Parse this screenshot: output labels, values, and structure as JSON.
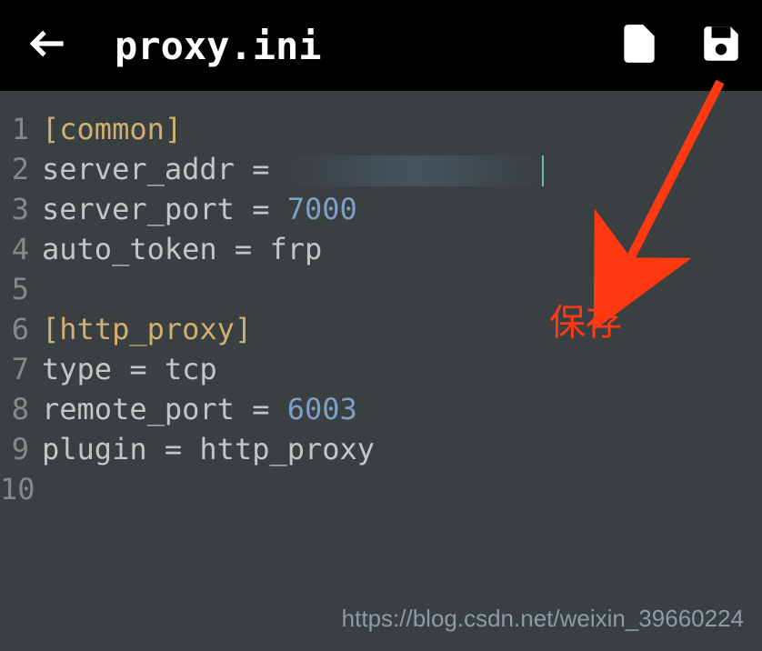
{
  "header": {
    "title": "proxy.ini"
  },
  "code": {
    "lines": [
      {
        "n": "1",
        "tokens": [
          {
            "t": "section",
            "v": "[common]"
          }
        ]
      },
      {
        "n": "2",
        "tokens": [
          {
            "t": "key",
            "v": "server_addr"
          },
          {
            "t": "eq",
            "v": " = "
          },
          {
            "t": "redacted",
            "v": ""
          }
        ]
      },
      {
        "n": "3",
        "tokens": [
          {
            "t": "key",
            "v": "server_port"
          },
          {
            "t": "eq",
            "v": " = "
          },
          {
            "t": "num",
            "v": "7000"
          }
        ]
      },
      {
        "n": "4",
        "tokens": [
          {
            "t": "key",
            "v": "auto_token"
          },
          {
            "t": "eq",
            "v": " = "
          },
          {
            "t": "val",
            "v": "frp"
          }
        ]
      },
      {
        "n": "5",
        "tokens": []
      },
      {
        "n": "6",
        "tokens": [
          {
            "t": "section",
            "v": "[http_proxy]"
          }
        ]
      },
      {
        "n": "7",
        "tokens": [
          {
            "t": "key",
            "v": "type"
          },
          {
            "t": "eq",
            "v": " = "
          },
          {
            "t": "val",
            "v": "tcp"
          }
        ]
      },
      {
        "n": "8",
        "tokens": [
          {
            "t": "key",
            "v": "remote_port"
          },
          {
            "t": "eq",
            "v": " = "
          },
          {
            "t": "num",
            "v": "6003"
          }
        ]
      },
      {
        "n": "9",
        "tokens": [
          {
            "t": "key",
            "v": "plugin"
          },
          {
            "t": "eq",
            "v": " = "
          },
          {
            "t": "val",
            "v": "http_proxy"
          }
        ]
      },
      {
        "n": "10",
        "tokens": []
      }
    ]
  },
  "annotation": {
    "label": "保存"
  },
  "watermark": "https://blog.csdn.net/weixin_39660224"
}
